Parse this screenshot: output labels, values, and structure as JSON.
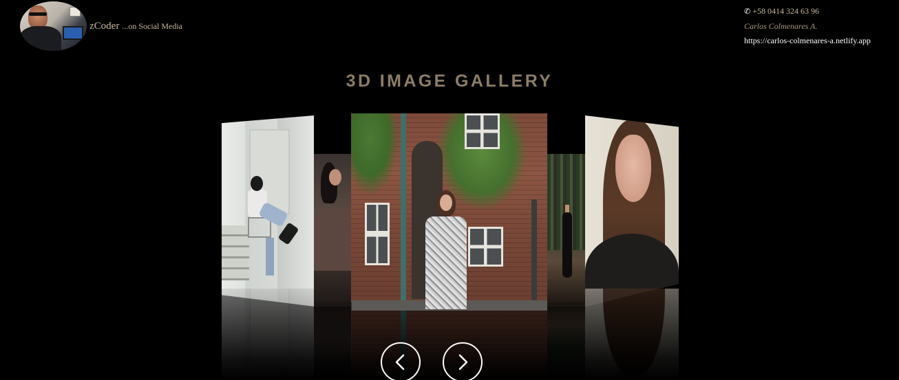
{
  "header": {
    "brand_name": "zCoder",
    "brand_sub": "...on Social Media",
    "avatar": "avatar-photo"
  },
  "contact": {
    "phone_icon": "phone-icon",
    "phone": "+58 0414 324 63 96",
    "author": "Carlos Colmenares A.",
    "website": "https://carlos-colmenares-a.netlify.app"
  },
  "gallery": {
    "title": "3D IMAGE GALLERY",
    "images": [
      {
        "subject": "woman-on-shopping-cart-photo"
      },
      {
        "subject": "woman-in-brown-dress-photo"
      },
      {
        "subject": "woman-in-front-of-brick-building-photo"
      },
      {
        "subject": "woman-in-forest-photo"
      },
      {
        "subject": "woman-portrait-photo"
      }
    ],
    "controls": {
      "prev_icon": "chevron-left-icon",
      "next_icon": "chevron-right-icon"
    }
  },
  "colors": {
    "background": "#000000",
    "title": "#8c7d66",
    "brand": "#c8b9a0",
    "button_border": "#ffffff"
  }
}
